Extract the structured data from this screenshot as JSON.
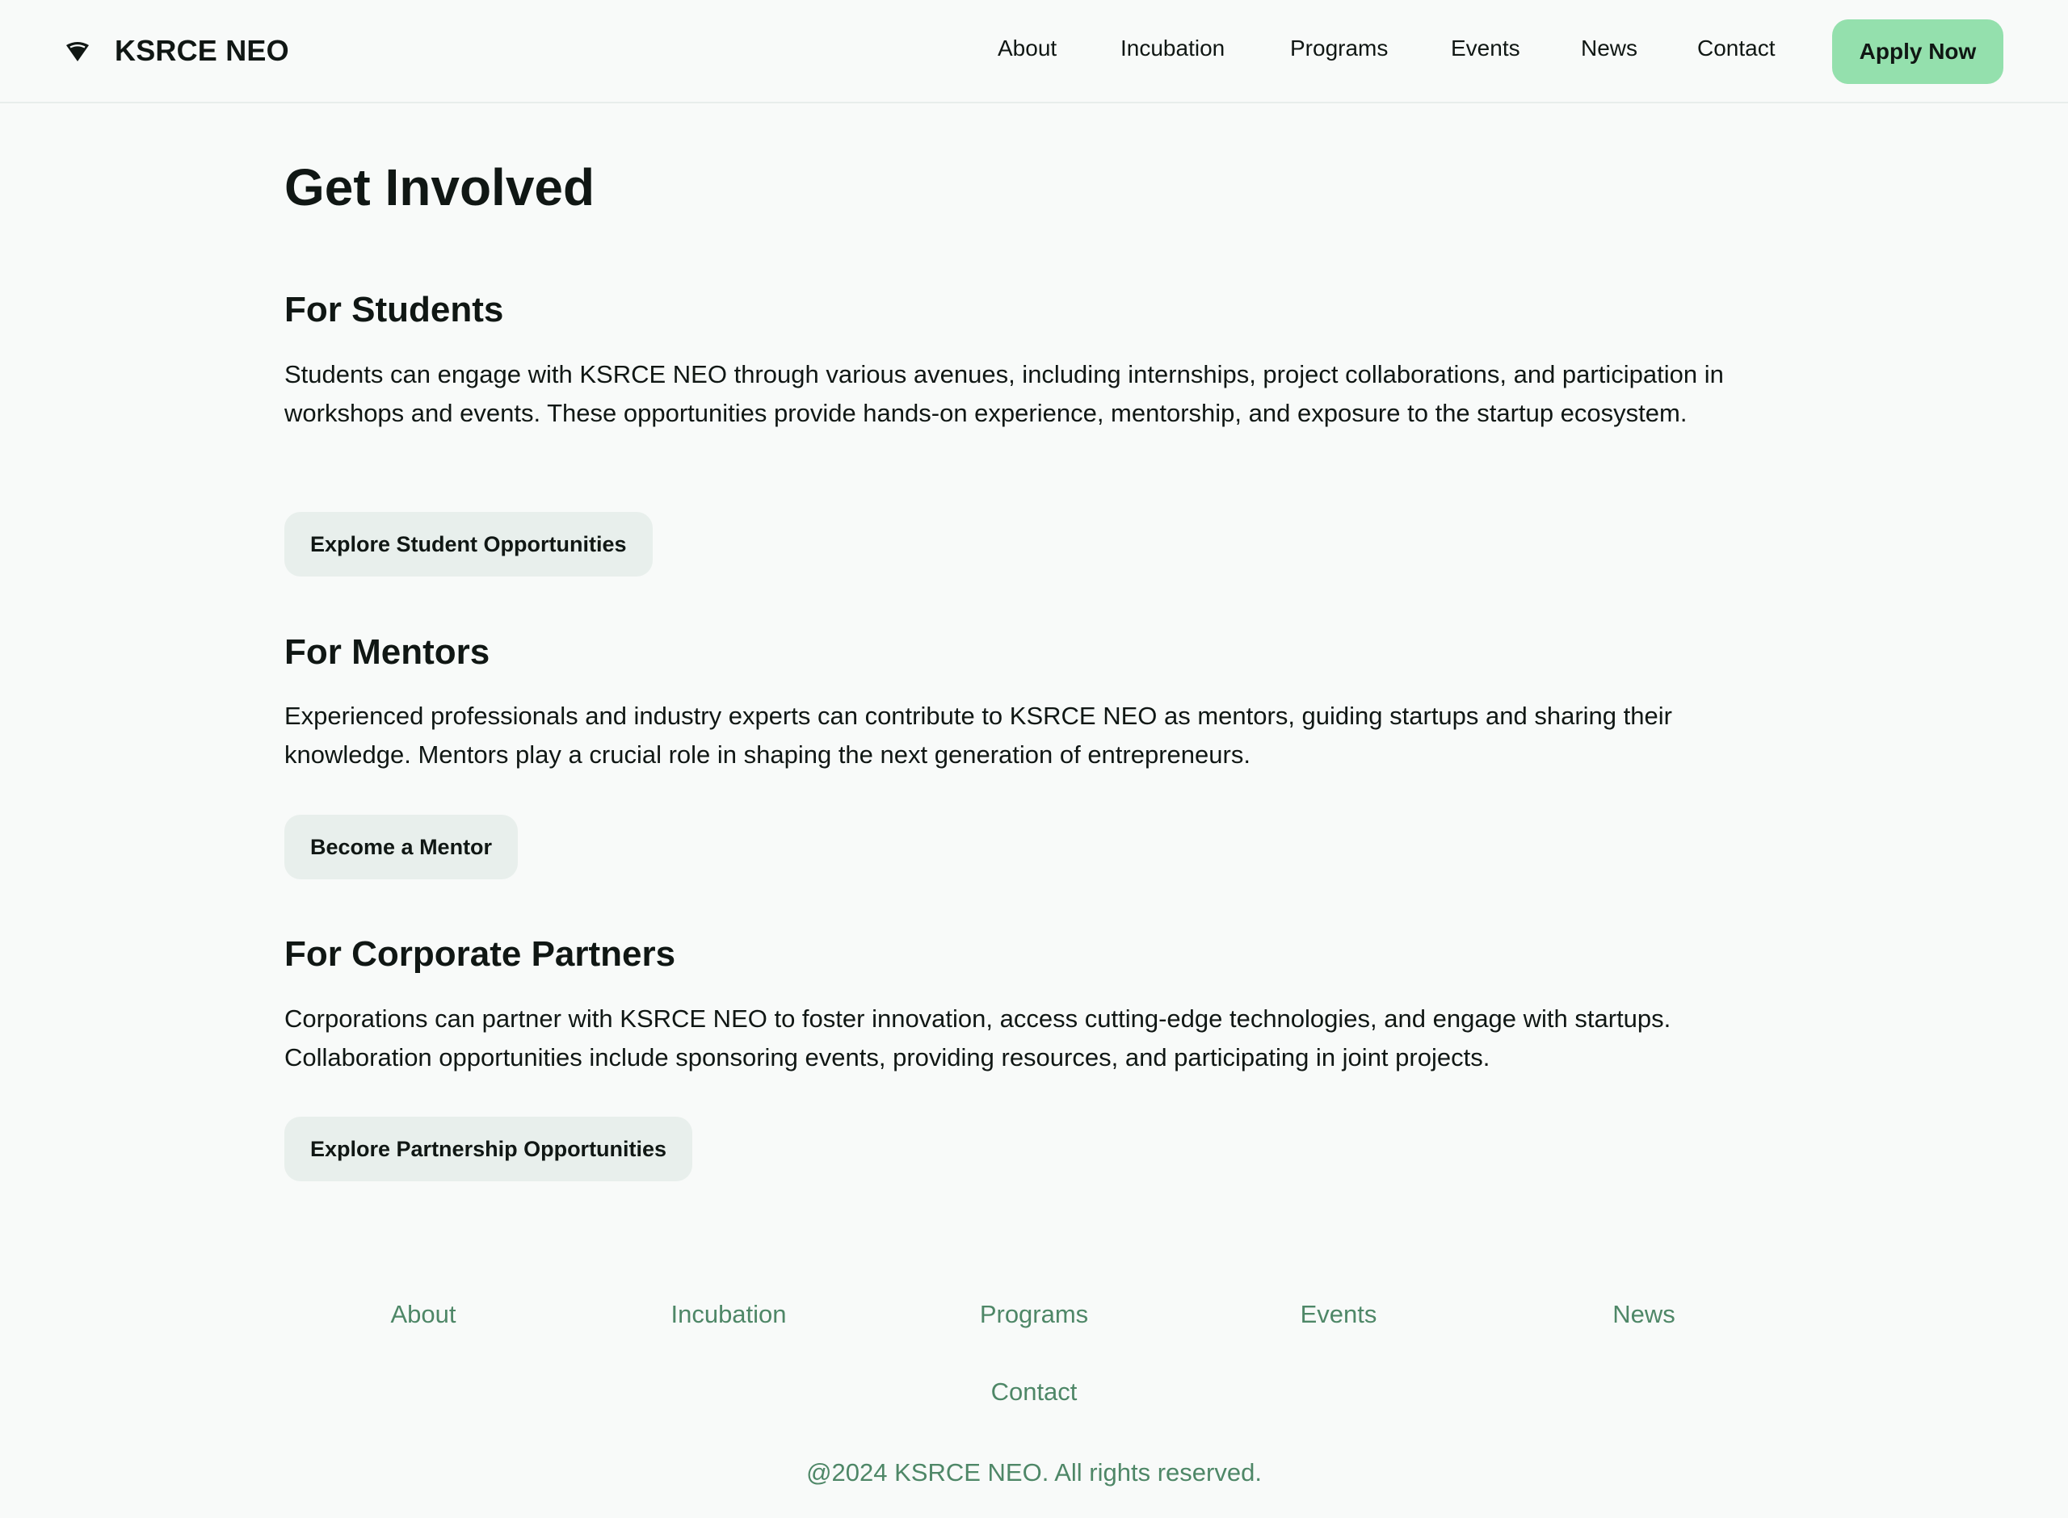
{
  "header": {
    "brand_name": "KSRCE NEO",
    "brand_icon": "wifi-signal-icon",
    "nav": [
      "About",
      "Incubation",
      "Programs",
      "Events",
      "News",
      "Contact"
    ],
    "apply_label": "Apply Now"
  },
  "main": {
    "title": "Get Involved",
    "sections": [
      {
        "title": "For Students",
        "text": "Students can engage with KSRCE NEO through various avenues, including internships, project collaborations, and participation in workshops and events. These opportunities provide hands-on experience, mentorship, and exposure to the startup ecosystem.",
        "button": "Explore Student Opportunities"
      },
      {
        "title": "For Mentors",
        "text": "Experienced professionals and industry experts can contribute to KSRCE NEO as mentors, guiding startups and sharing their knowledge. Mentors play a crucial role in shaping the next generation of entrepreneurs.",
        "button": "Become a Mentor"
      },
      {
        "title": "For Corporate Partners",
        "text": "Corporations can partner with KSRCE NEO to foster innovation, access cutting-edge technologies, and engage with startups. Collaboration opportunities include sponsoring events, providing resources, and participating in joint projects.",
        "button": "Explore Partnership Opportunities"
      }
    ]
  },
  "footer": {
    "links": [
      "About",
      "Incubation",
      "Programs",
      "Events",
      "News",
      "Contact"
    ],
    "copyright": "@2024 KSRCE NEO. All rights reserved."
  },
  "colors": {
    "background": "#f8faf9",
    "accent": "#94e0ad",
    "secondary_button": "#e8efec",
    "footer_text": "#4e8767"
  }
}
